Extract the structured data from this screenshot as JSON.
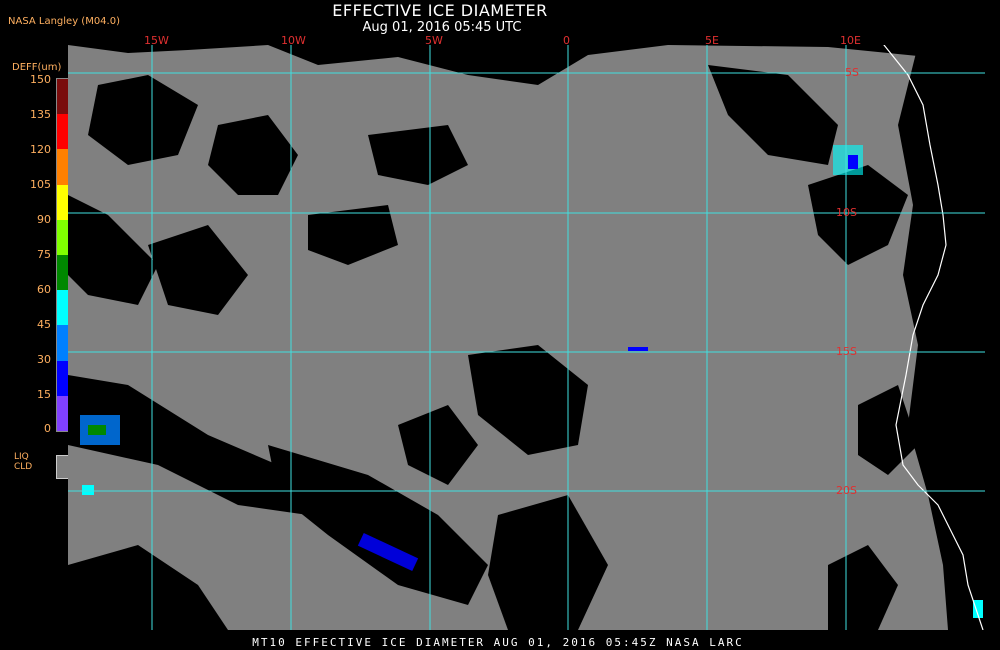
{
  "header": {
    "title": "EFFECTIVE ICE DIAMETER",
    "subtitle": "Aug 01, 2016 05:45 UTC",
    "credit": "NASA Langley (M04.0)"
  },
  "legend": {
    "title": "DEFF(um)",
    "ticks": [
      "150",
      "135",
      "120",
      "105",
      "90",
      "75",
      "60",
      "45",
      "30",
      "15",
      "0"
    ],
    "colors": [
      "#7a0c0c",
      "#ff0000",
      "#ff8000",
      "#ffff00",
      "#80ff00",
      "#008800",
      "#00ffff",
      "#0080ff",
      "#0000ff",
      "#8040ff"
    ],
    "liquid_label_1": "LIQ",
    "liquid_label_2": "CLD",
    "liquid_color": "#808080"
  },
  "map": {
    "lon_labels": [
      "15W",
      "10W",
      "5W",
      "0",
      "5E",
      "10E"
    ],
    "lat_labels": [
      "5S",
      "10S",
      "15S",
      "20S"
    ],
    "gridline_color": "#40e0e0",
    "label_color": "#e03030",
    "coast_color": "#ffffff"
  },
  "footer": {
    "text": "MT10  EFFECTIVE ICE DIAMETER  AUG 01, 2016 05:45Z  NASA LARC"
  }
}
